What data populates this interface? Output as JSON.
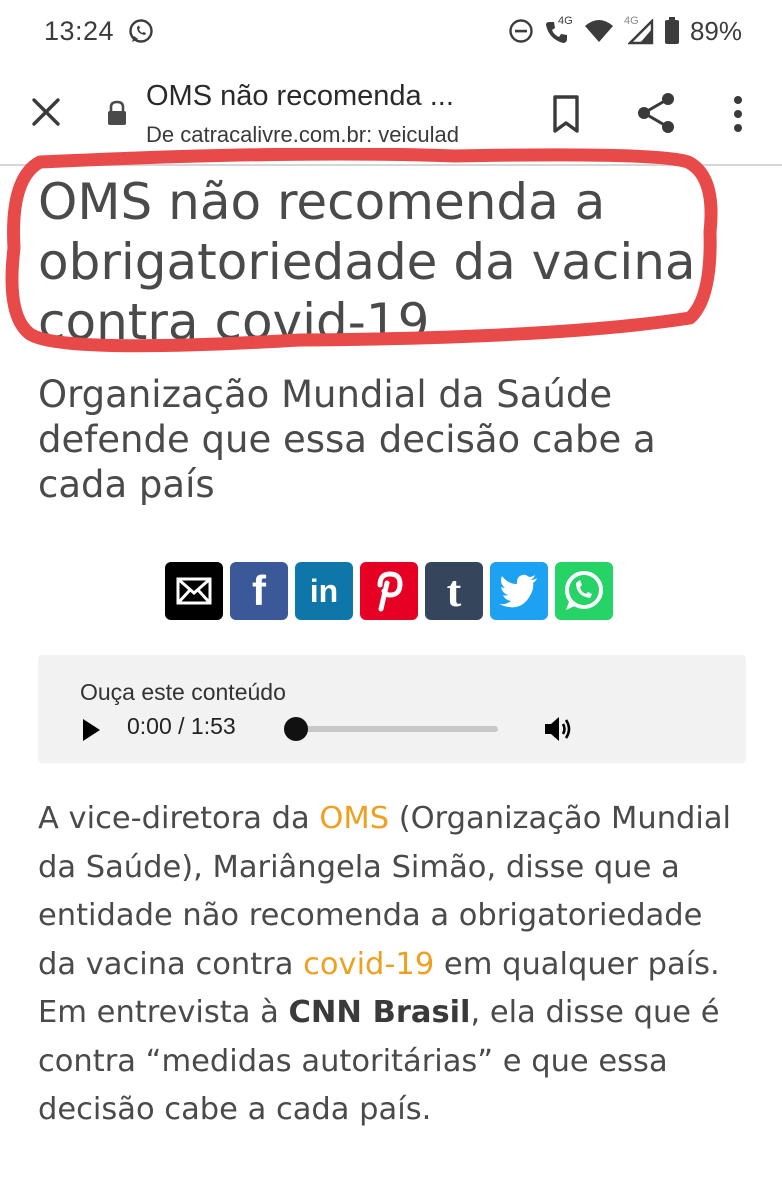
{
  "status_bar": {
    "time": "13:24",
    "network_small_1": "4G",
    "network_small_2": "4G",
    "battery_percent": "89%"
  },
  "toolbar": {
    "page_title": "OMS não recomenda ...",
    "url": "De catracalivre.com.br: veiculad"
  },
  "article": {
    "headline": "OMS não recomenda a obrigatoriedade da vacina contra covid-19",
    "subtitle": "Organização Mundial da Saúde defende que essa decisão cabe a cada país",
    "share_buttons": [
      "email-icon",
      "facebook-icon",
      "linkedin-icon",
      "pinterest-icon",
      "tumblr-icon",
      "twitter-icon",
      "whatsapp-icon"
    ],
    "share_labels": {
      "facebook": "f",
      "linkedin": "in",
      "tumblr": "t"
    },
    "audio": {
      "label": "Ouça este conteúdo",
      "time": "0:00 / 1:53",
      "progress": 0
    },
    "body": {
      "p1": "A vice-diretora da ",
      "link_oms": "OMS",
      "p2": " (Organização Mundial da Saúde), Mariângela Simão, disse que a entidade não recomenda a obrigatoriedade da vacina contra ",
      "link_covid": "covid-19",
      "p3": " em qualquer país. Em entrevista à ",
      "bold_cnn": "CNN Brasil",
      "p4": ", ela disse que é contra “medidas autoritárias” e que essa decisão cabe a cada país."
    }
  },
  "colors": {
    "link": "#f0a020",
    "highlight_circle": "#e84a4a",
    "facebook": "#3b5998",
    "linkedin": "#0e76a8",
    "pinterest": "#e60023",
    "tumblr": "#35465c",
    "twitter": "#1da1f2",
    "whatsapp": "#25d366"
  }
}
